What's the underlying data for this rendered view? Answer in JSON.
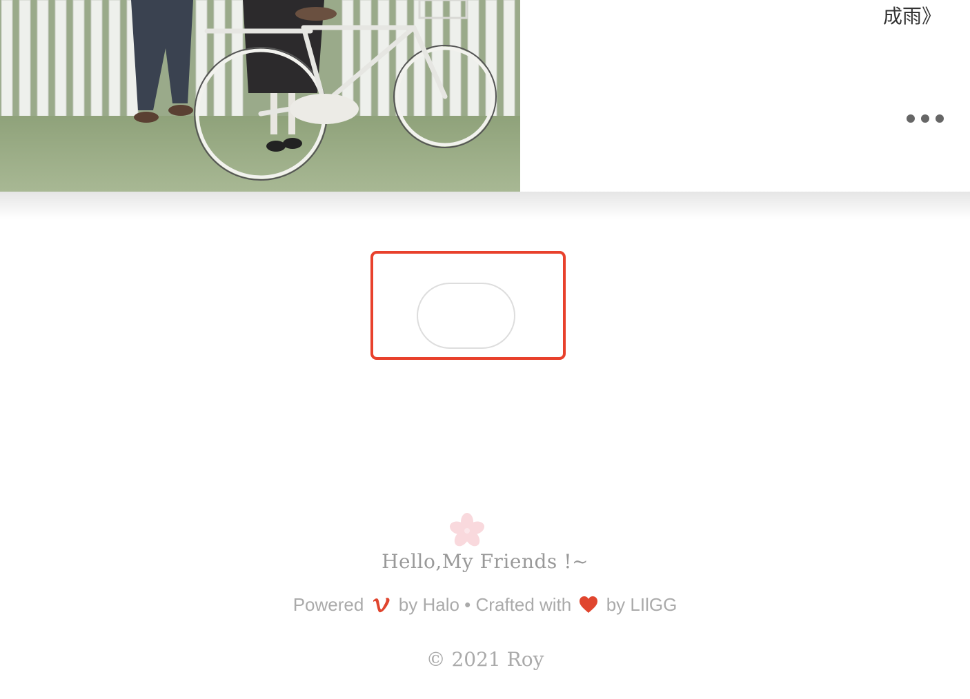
{
  "post": {
    "title_fragment": "成雨》",
    "image_alt": "Two people standing beside a white bicycle in front of a white picket fence on grass",
    "more_icon": "ellipsis-icon"
  },
  "highlight": {
    "color": "#e8412c"
  },
  "load_more": {
    "label": ""
  },
  "footer": {
    "flower_icon": "sakura-icon",
    "greeting": "Hello,My Friends !~",
    "powered_prefix": "Powered",
    "powered_icon": "vimeo-icon",
    "powered_by": "by Halo",
    "separator": "•",
    "crafted_with": "Crafted with",
    "heart_icon": "heart-icon",
    "crafted_by": "by LIlGG",
    "copyright": "© 2021 Roy"
  },
  "colors": {
    "accent": "#e0452e",
    "muted_text": "#aaaaaa",
    "greeting_text": "#999999"
  }
}
